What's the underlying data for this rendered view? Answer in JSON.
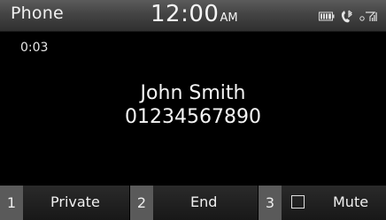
{
  "header": {
    "app_title": "Phone",
    "clock": {
      "time": "12:00",
      "ampm": "AM"
    },
    "icons": [
      "battery-icon",
      "bluetooth-handsfree-icon",
      "signal-strength-icon"
    ]
  },
  "call": {
    "duration": "0:03",
    "caller_name": "John Smith",
    "caller_number": "01234567890"
  },
  "softkeys": [
    {
      "number": "1",
      "label": "Private"
    },
    {
      "number": "2",
      "label": "End"
    },
    {
      "number": "3",
      "label": "Mute",
      "checkbox_checked": false
    }
  ]
}
